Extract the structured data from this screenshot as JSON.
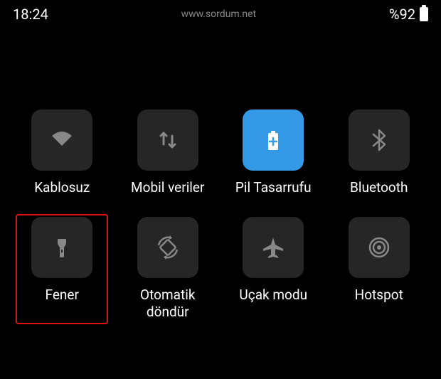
{
  "status": {
    "time": "18:24",
    "url": "www.sordum.net",
    "battery_percent": "%92"
  },
  "tiles": {
    "wifi": {
      "label": "Kablosuz"
    },
    "mobile_data": {
      "label": "Mobil veriler"
    },
    "battery_saver": {
      "label": "Pil Tasarrufu"
    },
    "bluetooth": {
      "label": "Bluetooth"
    },
    "flashlight": {
      "label": "Fener"
    },
    "auto_rotate": {
      "label": "Otomatik döndür"
    },
    "airplane": {
      "label": "Uçak modu"
    },
    "hotspot": {
      "label": "Hotspot"
    }
  }
}
